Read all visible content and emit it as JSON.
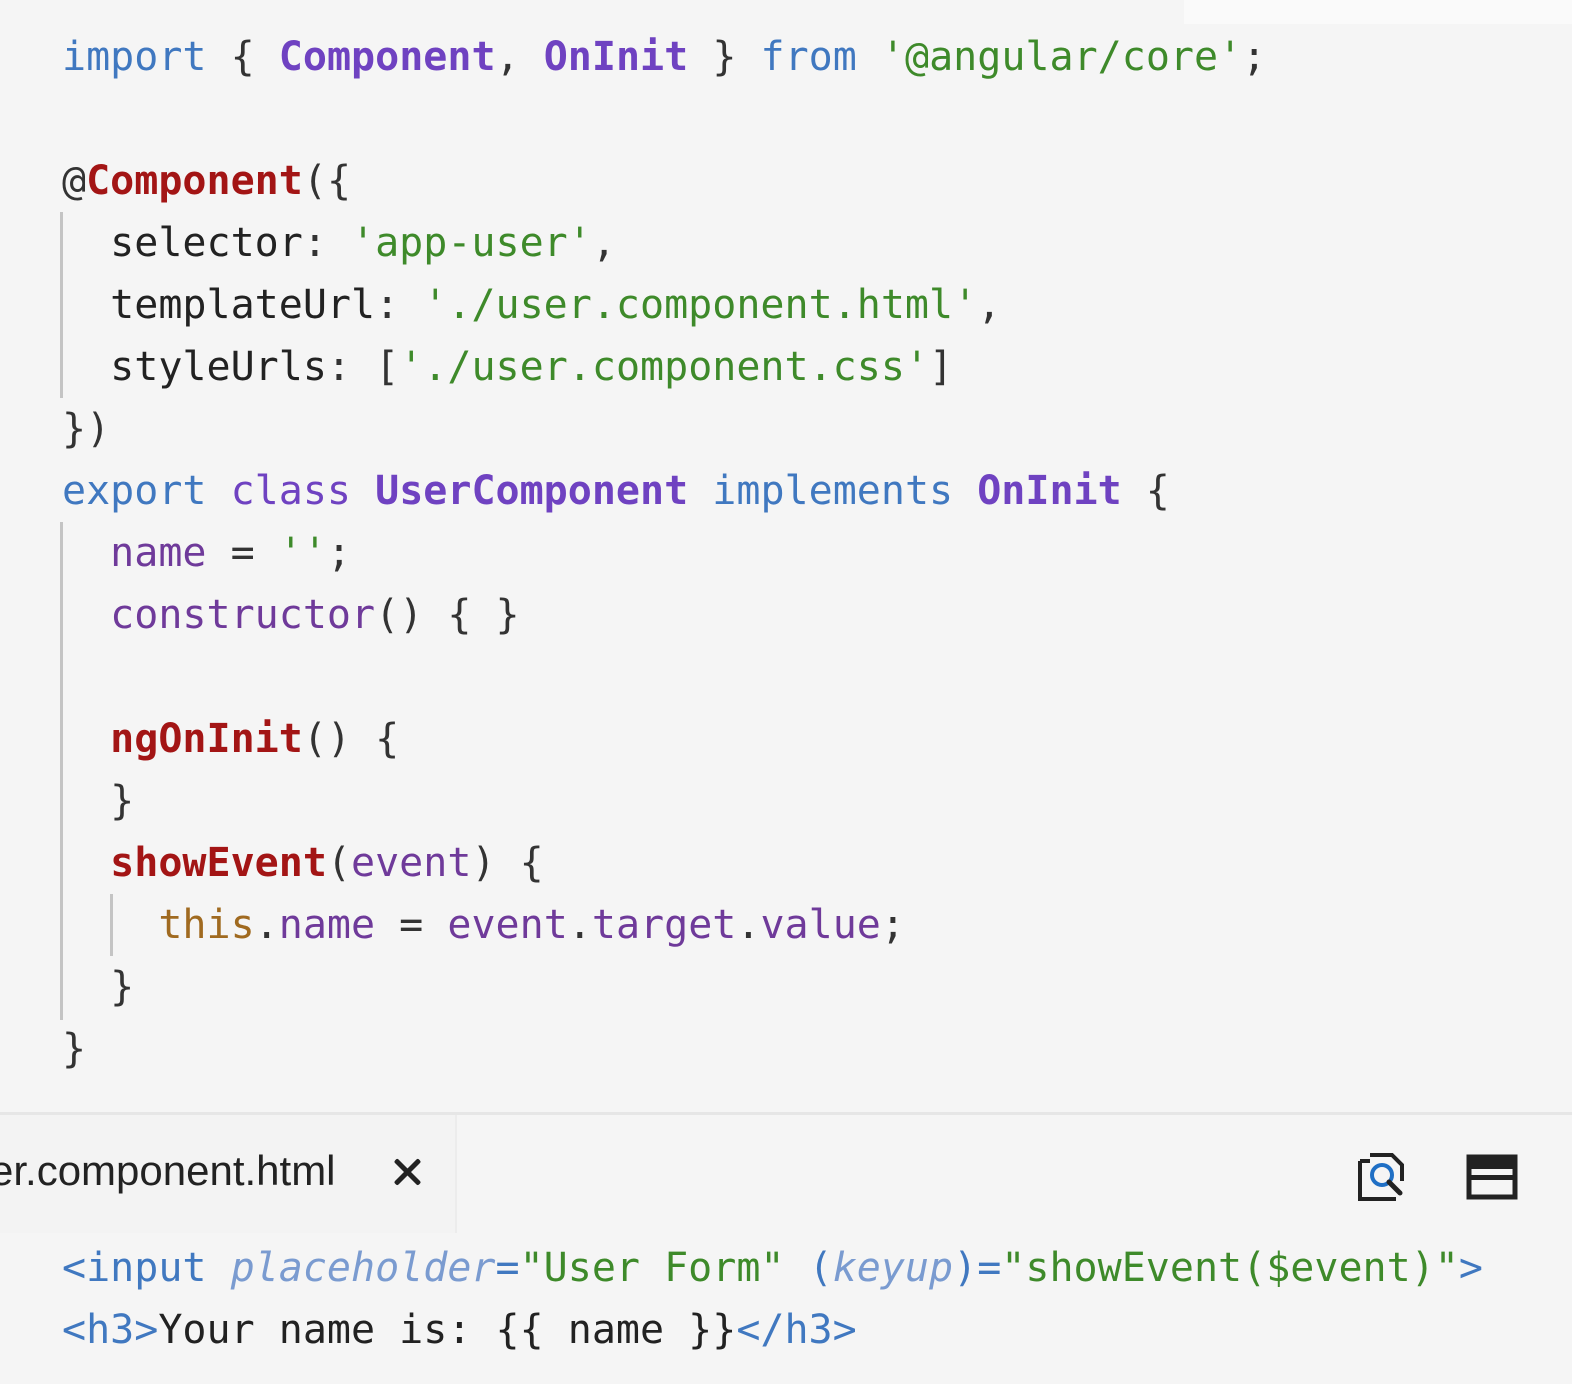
{
  "code_editor": {
    "language": "typescript",
    "lines": [
      "import { Component, OnInit } from '@angular/core';",
      "",
      "@Component({",
      "  selector: 'app-user',",
      "  templateUrl: './user.component.html',",
      "  styleUrls: ['./user.component.css']",
      "})",
      "export class UserComponent implements OnInit {",
      "  name = '';",
      "  constructor() { }",
      "",
      "  ngOnInit() {",
      "  }",
      "  showEvent(event) {",
      "    this.name = event.target.value;",
      "  }",
      "}"
    ]
  },
  "bottom_panel": {
    "tab": {
      "label": "er.component.html",
      "close_icon": "close-icon"
    },
    "toolbar": {
      "preview_icon": "search-document-icon",
      "split_icon": "split-layout-icon"
    },
    "html_lines": [
      "<input placeholder=\"User Form\" (keyup)=\"showEvent($event)\">",
      "<h3>Your name is: {{ name }}</h3>"
    ]
  },
  "colors": {
    "background": "#f5f5f5",
    "keyword": "#4078c0",
    "class_name": "#6f42c1",
    "string": "#3e8a2a",
    "decorator": "#a31515",
    "this_keyword": "#a06a20"
  }
}
